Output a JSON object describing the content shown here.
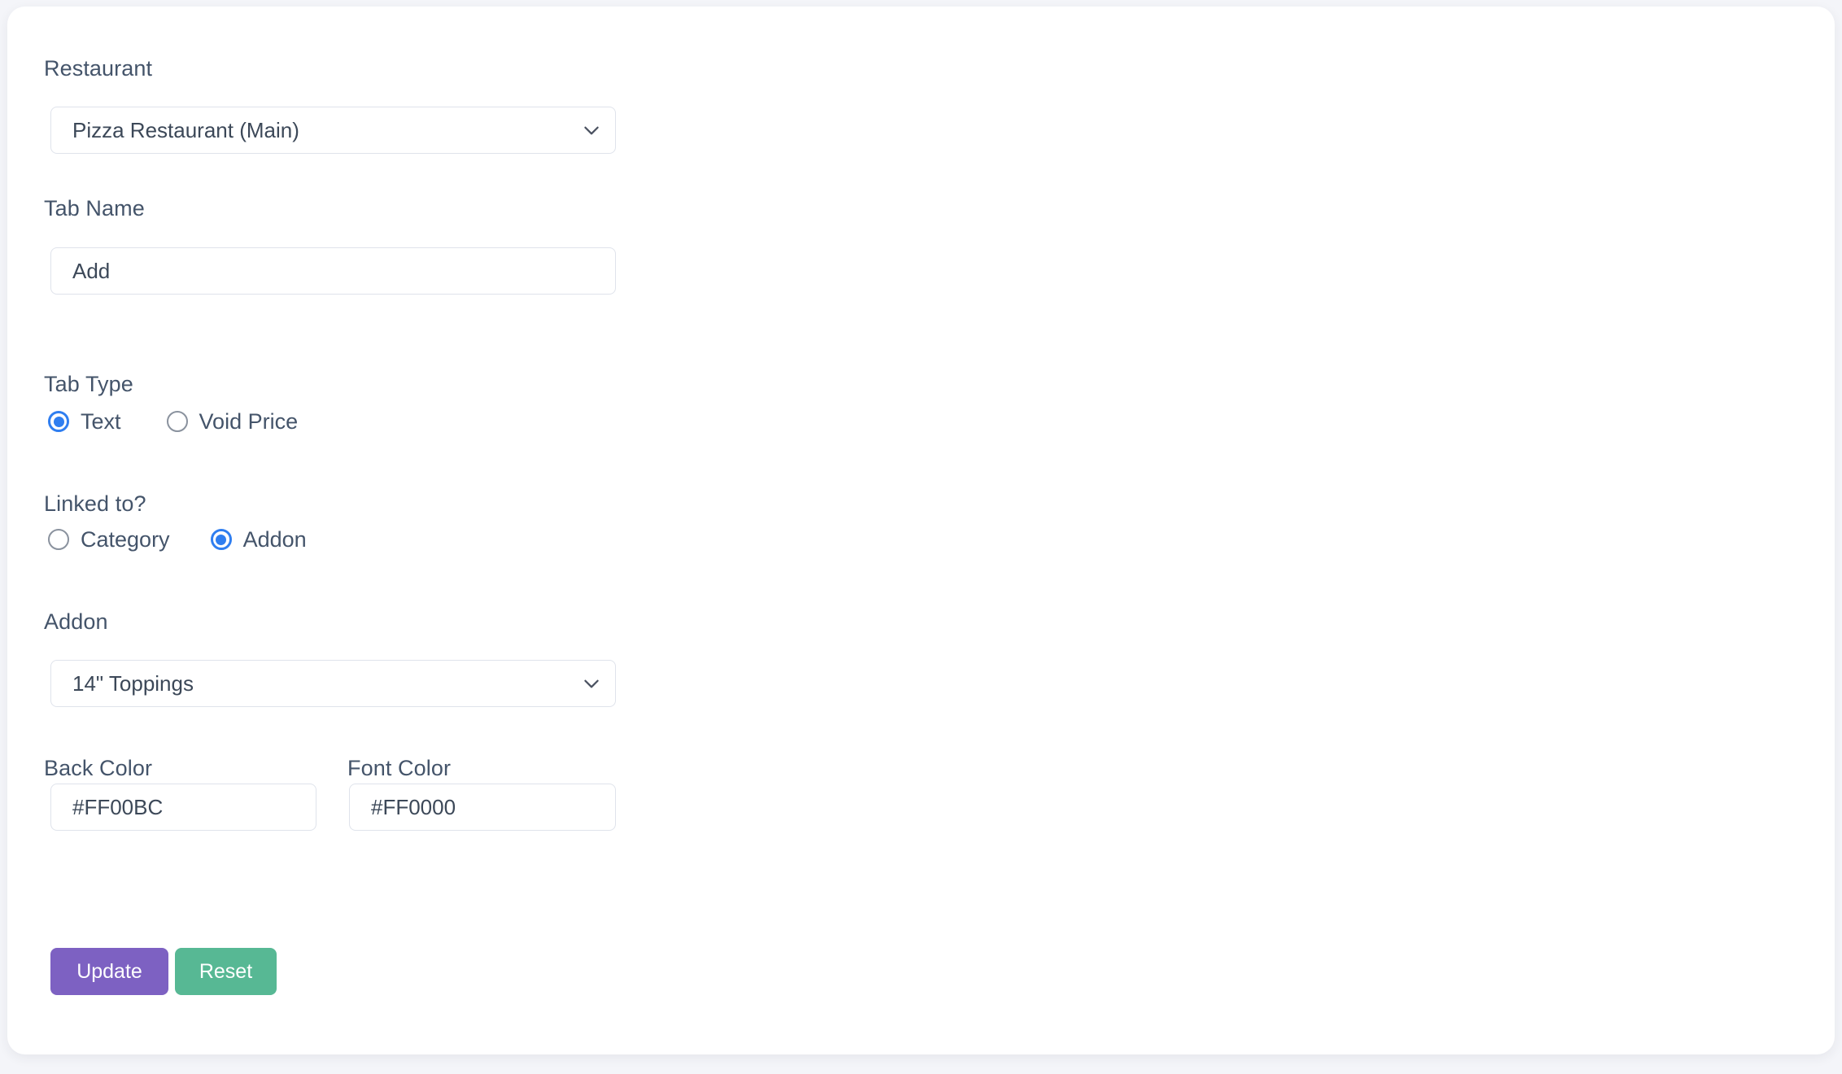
{
  "form": {
    "restaurant": {
      "label": "Restaurant",
      "selected": "Pizza Restaurant (Main)",
      "icon": "chevron-down-icon"
    },
    "tab_name": {
      "label": "Tab Name",
      "value": "Add",
      "placeholder": "Tab Name"
    },
    "tab_type": {
      "label": "Tab Type",
      "options": [
        {
          "label": "Text",
          "checked": true
        },
        {
          "label": "Void Price",
          "checked": false
        }
      ]
    },
    "linked_to": {
      "label": "Linked to?",
      "options": [
        {
          "label": "Category",
          "checked": false
        },
        {
          "label": "Addon",
          "checked": true
        }
      ]
    },
    "addon": {
      "label": "Addon",
      "selected": "14\" Toppings",
      "icon": "chevron-down-icon"
    },
    "back_color": {
      "label": "Back Color",
      "value": "#FF00BC",
      "placeholder": "Back Color"
    },
    "font_color": {
      "label": "Font Color",
      "value": "#FF0000",
      "placeholder": "Font Color"
    }
  },
  "actions": {
    "update_label": "Update",
    "reset_label": "Reset"
  },
  "colors": {
    "update_button": "#7d61c2",
    "reset_button": "#57b894",
    "radio_accent": "#2f7ef0",
    "label_text": "#44546a",
    "page_background": "#f4f5f9",
    "card_background": "#ffffff",
    "control_border": "#dfe3eb"
  }
}
